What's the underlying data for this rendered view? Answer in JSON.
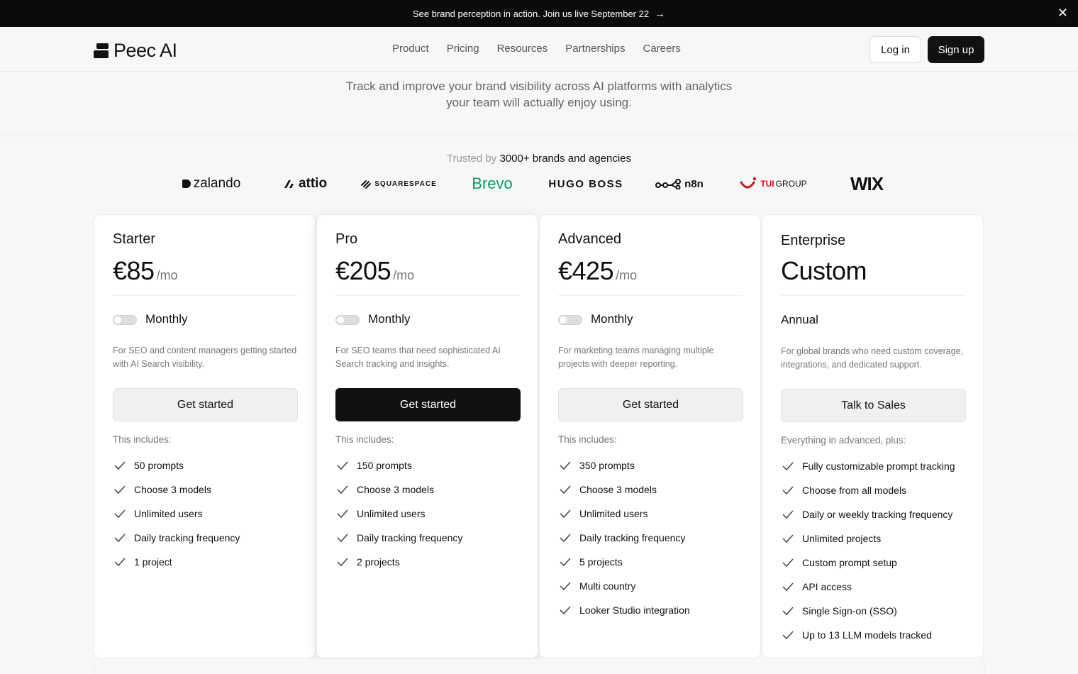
{
  "banner": {
    "text": "See brand perception in action. Join us live September 22",
    "arrow_icon": "arrow-right-icon",
    "close_icon": "close-icon"
  },
  "nav": {
    "logo_text": "Peec AI",
    "links": [
      "Product",
      "Pricing",
      "Resources",
      "Partnerships",
      "Careers"
    ],
    "login_label": "Log in",
    "signup_label": "Sign up"
  },
  "hero": {
    "subtitle_line1": "Track and improve your brand visibility across AI platforms with analytics",
    "subtitle_line2": "your team will actually enjoy using."
  },
  "trusted": {
    "prefix": "Trusted by",
    "highlight": "3000+ brands and agencies",
    "brands": [
      "zalando",
      "attio",
      "SQUARESPACE",
      "Brevo",
      "HUGO BOSS",
      "n8n",
      "TUI",
      "GROUP",
      "WIX"
    ]
  },
  "plans": [
    {
      "name": "Starter",
      "price": "€85",
      "period": "/mo",
      "billing": "Monthly",
      "description": "For SEO and content managers getting started with AI Search visibility.",
      "cta": "Get started",
      "includes_label": "This includes:",
      "features": [
        "50 prompts",
        "Choose 3 models",
        "Unlimited users",
        "Daily tracking frequency",
        "1 project"
      ]
    },
    {
      "name": "Pro",
      "price": "€205",
      "period": "/mo",
      "billing": "Monthly",
      "description": "For SEO teams that need sophisticated AI Search tracking and insights.",
      "cta": "Get started",
      "includes_label": "This includes:",
      "features": [
        "150 prompts",
        "Choose 3 models",
        "Unlimited users",
        "Daily tracking frequency",
        "2 projects"
      ]
    },
    {
      "name": "Advanced",
      "price": "€425",
      "period": "/mo",
      "billing": "Monthly",
      "description": "For marketing teams managing multiple projects with deeper reporting.",
      "cta": "Get started",
      "includes_label": "This includes:",
      "features": [
        "350 prompts",
        "Choose 3 models",
        "Unlimited users",
        "Daily tracking frequency",
        "5 projects",
        "Multi country",
        "Looker Studio integration"
      ]
    },
    {
      "name": "Enterprise",
      "price": "Custom",
      "billing": "Annual",
      "description": "For global brands who need custom coverage, integrations, and dedicated support.",
      "cta": "Talk to Sales",
      "includes_label": "Everything in advanced, plus:",
      "features": [
        "Fully customizable prompt tracking",
        "Choose from all models",
        "Daily or weekly tracking frequency",
        "Unlimited projects",
        "Custom prompt setup",
        "API access",
        "Single Sign-on (SSO)",
        "Up to 13 LLM models tracked"
      ]
    }
  ]
}
